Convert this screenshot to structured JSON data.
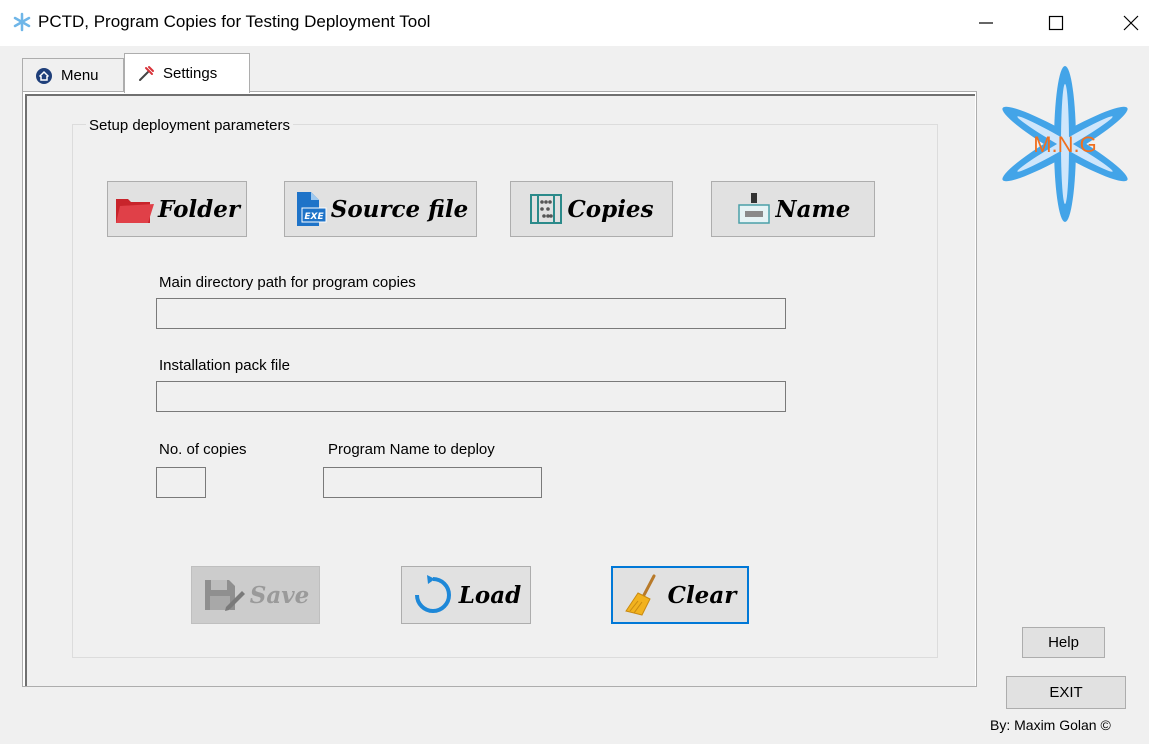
{
  "window": {
    "title": "PCTD, Program Copies for Testing Deployment Tool",
    "minimize_icon": "minimize-icon",
    "maximize_icon": "maximize-icon",
    "close_icon": "close-icon"
  },
  "tabs": [
    {
      "label": "Menu",
      "icon": "home-icon",
      "selected": false
    },
    {
      "label": "Settings",
      "icon": "settings-icon",
      "selected": true
    }
  ],
  "group": {
    "label": "Setup deployment parameters"
  },
  "buttons": {
    "folder": "Folder",
    "source_file": "Source file",
    "copies": "Copies",
    "name": "Name",
    "save": "Save",
    "load": "Load",
    "clear": "Clear"
  },
  "fields": {
    "main_dir_label": "Main directory path for program copies",
    "main_dir_value": "",
    "pack_label": "Installation pack file",
    "pack_value": "",
    "copies_label": "No. of copies",
    "copies_value": "",
    "program_name_label": "Program Name to deploy",
    "program_name_value": ""
  },
  "logo": {
    "text": "M.N.G",
    "petal_color": "#3aa0e8",
    "text_color": "#f07020"
  },
  "footer": {
    "help": "Help",
    "exit": "EXIT",
    "credit": "By: Maxim Golan ©"
  },
  "colors": {
    "accent": "#0078d7",
    "folder_red": "#c8242b",
    "exe_blue": "#1e73c8"
  }
}
